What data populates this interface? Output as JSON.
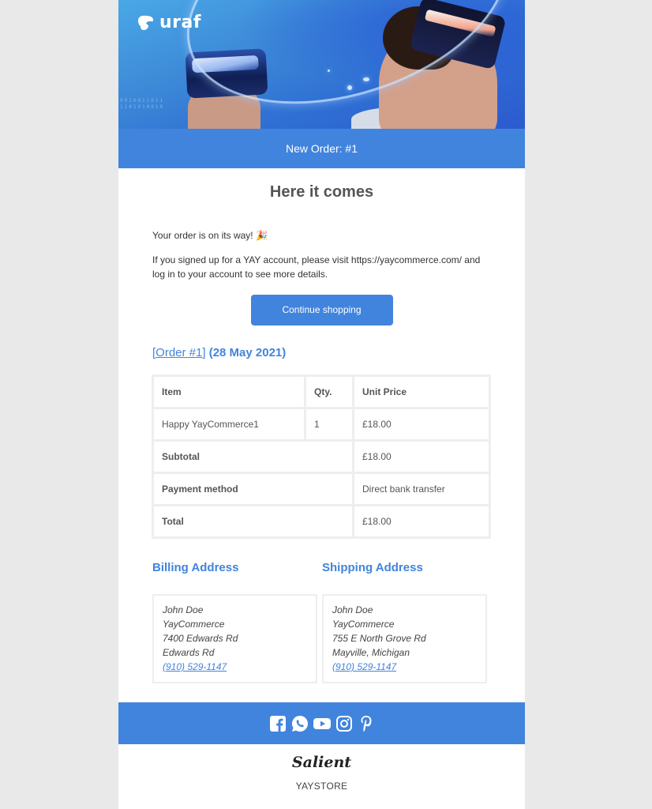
{
  "header": {
    "logo_text": "uraf",
    "binary_line_1": "0010011011",
    "binary_line_2": "1101010010",
    "title": "New Order: #1"
  },
  "main": {
    "heading": "Here it comes",
    "intro": "Your order is on its way! 🎉",
    "account_note": "If you signed up for a YAY account, please visit https://yaycommerce.com/ and log in to your account to see more details.",
    "cta_label": "Continue shopping"
  },
  "order": {
    "link_label": "[Order #1]",
    "date": "(28 May 2021)",
    "columns": [
      "Item",
      "Qty.",
      "Unit Price"
    ],
    "items": [
      {
        "name": "Happy YayCommerce1",
        "qty": "1",
        "price": "£18.00"
      }
    ],
    "totals": [
      {
        "label": "Subtotal",
        "value": "£18.00"
      },
      {
        "label": "Payment method",
        "value": "Direct bank transfer"
      },
      {
        "label": "Total",
        "value": "£18.00"
      }
    ]
  },
  "billing": {
    "title": "Billing Address",
    "name": "John Doe",
    "company": "YayCommerce",
    "line1": "7400 Edwards Rd",
    "line2": "Edwards Rd",
    "phone": "(910) 529-1147"
  },
  "shipping": {
    "title": "Shipping Address",
    "name": "John Doe",
    "company": "YayCommerce",
    "line1": "755 E North Grove Rd",
    "line2": "Mayville, Michigan",
    "phone": "(910) 529-1147"
  },
  "footer": {
    "social_icons": [
      "facebook-icon",
      "whatsapp-icon",
      "youtube-icon",
      "instagram-icon",
      "pinterest-icon"
    ],
    "brand_logo_text": "Salient",
    "store_name": "YAYSTORE"
  },
  "colors": {
    "accent": "#4184dd",
    "page_background": "#e9e9e9",
    "text": "#555555"
  }
}
